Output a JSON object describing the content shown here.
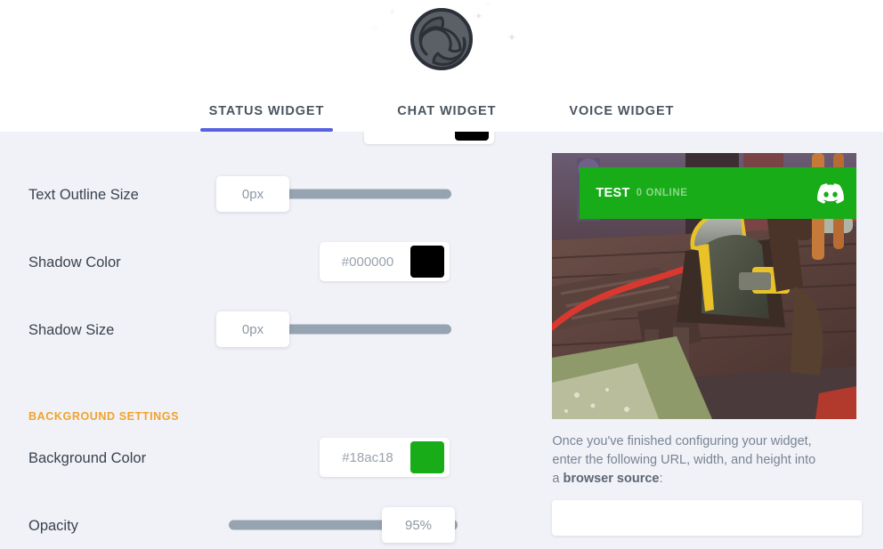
{
  "header": {
    "logo_icon": "obs-logo-icon",
    "sparkles": [
      "sparkle",
      "sparkle",
      "sparkle",
      "sparkle",
      "sparkle",
      "sparkle"
    ],
    "tabs": [
      {
        "label": "STATUS WIDGET",
        "active": true
      },
      {
        "label": "CHAT WIDGET",
        "active": false
      },
      {
        "label": "VOICE WIDGET",
        "active": false
      }
    ]
  },
  "colors": {
    "accent_tab": "#5762e0",
    "section_heading": "#f0a32e",
    "slider_track": "#96a3b0",
    "page_background": "#f1f2f7",
    "shadow_color_value": "#000000",
    "background_color_value": "#18ac18"
  },
  "form": {
    "top_partial_color_field": {
      "label": "",
      "value": "",
      "swatch": "#000000"
    },
    "rows": [
      {
        "label": "Text Outline Size",
        "type": "slider",
        "value": "0px",
        "percent": 0
      },
      {
        "label": "Shadow Color",
        "type": "color",
        "value": "#000000",
        "swatch": "#000000"
      },
      {
        "label": "Shadow Size",
        "type": "slider",
        "value": "0px",
        "percent": 0
      }
    ],
    "background_section": {
      "title": "BACKGROUND SETTINGS",
      "rows": [
        {
          "label": "Background Color",
          "type": "color",
          "value": "#18ac18",
          "swatch": "#18ac18"
        },
        {
          "label": "Opacity",
          "type": "slider",
          "value": "95%",
          "percent": 95
        }
      ]
    }
  },
  "preview": {
    "widget": {
      "name": "TEST",
      "online_text": "0 ONLINE",
      "background": "#18ac18",
      "brand_icon": "discord-icon"
    },
    "scene_description": "game-screenshot-background"
  },
  "instructions": {
    "line1": "Once you've finished configuring your widget,",
    "line2": "enter the following URL, width, and height into",
    "line3_prefix": "a ",
    "line3_bold": "browser source",
    "line3_suffix": ":"
  },
  "url_field": {
    "value": "",
    "placeholder": ""
  }
}
